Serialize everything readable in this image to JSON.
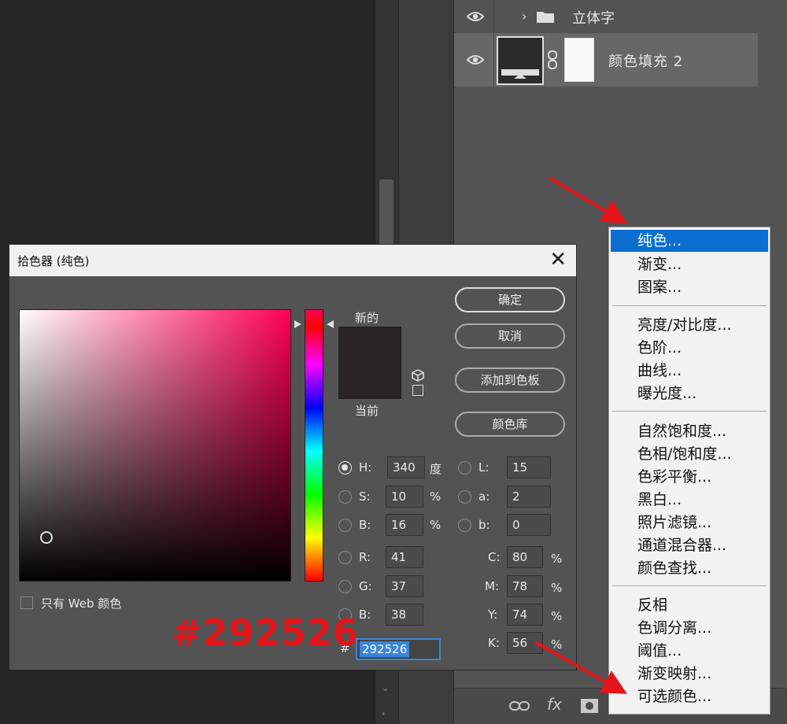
{
  "layers": {
    "group_name": "立体字",
    "fill_layer_name": "颜色填充 2"
  },
  "dialog": {
    "title": "拾色器 (纯色)",
    "close_glyph": "✕",
    "new_label": "新的",
    "current_label": "当前",
    "buttons": {
      "ok": "确定",
      "cancel": "取消",
      "add_swatch": "添加到色板",
      "color_library": "颜色库"
    },
    "fields": {
      "H": {
        "label": "H:",
        "value": "340",
        "unit": "度"
      },
      "S": {
        "label": "S:",
        "value": "10",
        "unit": "%"
      },
      "Bv": {
        "label": "B:",
        "value": "16",
        "unit": "%"
      },
      "R": {
        "label": "R:",
        "value": "41"
      },
      "G": {
        "label": "G:",
        "value": "37"
      },
      "B": {
        "label": "B:",
        "value": "38"
      },
      "L": {
        "label": "L:",
        "value": "15"
      },
      "a": {
        "label": "a:",
        "value": "2"
      },
      "b": {
        "label": "b:",
        "value": "0"
      },
      "C": {
        "label": "C:",
        "value": "80",
        "unit": "%"
      },
      "M": {
        "label": "M:",
        "value": "78",
        "unit": "%"
      },
      "Y": {
        "label": "Y:",
        "value": "74",
        "unit": "%"
      },
      "K": {
        "label": "K:",
        "value": "56",
        "unit": "%"
      }
    },
    "hash_label": "#",
    "hex_value": "292526",
    "web_only_label": "只有 Web 颜色",
    "swatch_color": "#292526"
  },
  "annotation": "#292526",
  "menu": {
    "items": [
      "纯色...",
      "渐变...",
      "图案...",
      "亮度/对比度...",
      "色阶...",
      "曲线...",
      "曝光度...",
      "自然饱和度...",
      "色相/饱和度...",
      "色彩平衡...",
      "黑白...",
      "照片滤镜...",
      "通道混合器...",
      "颜色查找...",
      "反相",
      "色调分离...",
      "阈值...",
      "渐变映射...",
      "可选颜色..."
    ],
    "selected_index": 0
  },
  "bottom_icons": {
    "link": "link-icon",
    "fx": "fx"
  },
  "colors": {
    "accent_red": "#e4141b",
    "selection_blue": "#0a6fd0"
  }
}
